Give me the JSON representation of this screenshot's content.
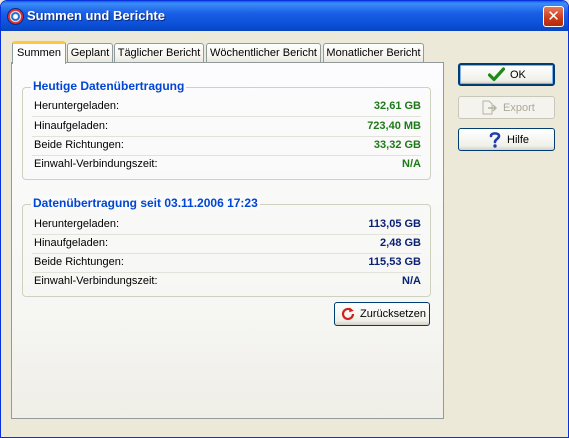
{
  "window": {
    "title": "Summen und Berichte",
    "close_glyph": "✕"
  },
  "tabs": [
    {
      "label": "Summen",
      "active": true
    },
    {
      "label": "Geplant",
      "active": false
    },
    {
      "label": "Täglicher Bericht",
      "active": false
    },
    {
      "label": "Wöchentlicher Bericht",
      "active": false
    },
    {
      "label": "Monatlicher Bericht",
      "active": false
    }
  ],
  "today": {
    "title": "Heutige Datenübertragung",
    "rows": [
      {
        "label": "Heruntergeladen:",
        "value": "32,61 GB"
      },
      {
        "label": "Hinaufgeladen:",
        "value": "723,40 MB"
      },
      {
        "label": "Beide Richtungen:",
        "value": "33,32 GB"
      },
      {
        "label": "Einwahl-Verbindungszeit:",
        "value": "N/A"
      }
    ],
    "value_color": "#1e7a18"
  },
  "since": {
    "title": "Datenübertragung seit 03.11.2006 17:23",
    "rows": [
      {
        "label": "Heruntergeladen:",
        "value": "113,05 GB"
      },
      {
        "label": "Hinaufgeladen:",
        "value": "2,48 GB"
      },
      {
        "label": "Beide Richtungen:",
        "value": "115,53 GB"
      },
      {
        "label": "Einwahl-Verbindungszeit:",
        "value": "N/A"
      }
    ],
    "value_color": "#0b2274"
  },
  "buttons": {
    "reset": {
      "label": "Zurücksetzen",
      "icon": "refresh-icon"
    },
    "ok": {
      "label": "OK",
      "icon": "checkmark-icon"
    },
    "export": {
      "label": "Export",
      "icon": "export-icon",
      "enabled": false
    },
    "help": {
      "label": "Hilfe",
      "icon": "question-icon"
    }
  }
}
